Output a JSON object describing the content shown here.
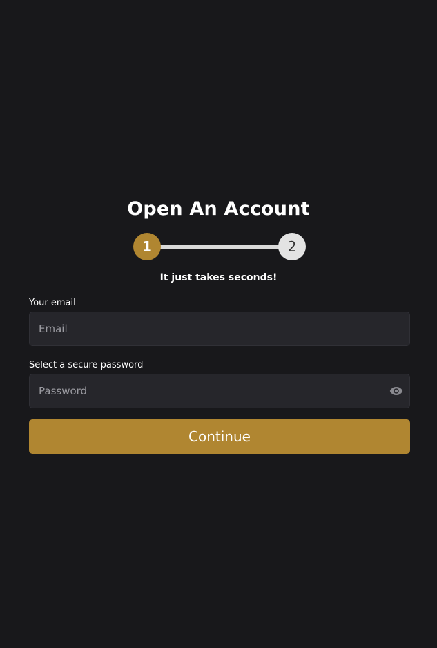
{
  "header": {
    "title": "Open An Account",
    "subtitle": "It just takes seconds!"
  },
  "stepper": {
    "current_step": 1,
    "total_steps": 2,
    "steps": [
      {
        "label": "1",
        "state": "active"
      },
      {
        "label": "2",
        "state": "inactive"
      }
    ]
  },
  "form": {
    "email": {
      "label": "Your email",
      "placeholder": "Email",
      "value": ""
    },
    "password": {
      "label": "Select a secure password",
      "placeholder": "Password",
      "value": "",
      "toggle_icon": "eye-icon"
    },
    "continue_label": "Continue"
  },
  "colors": {
    "background": "#18181b",
    "accent": "#b08631",
    "input_background": "#26262b",
    "step_inactive": "#e3e3e3"
  }
}
